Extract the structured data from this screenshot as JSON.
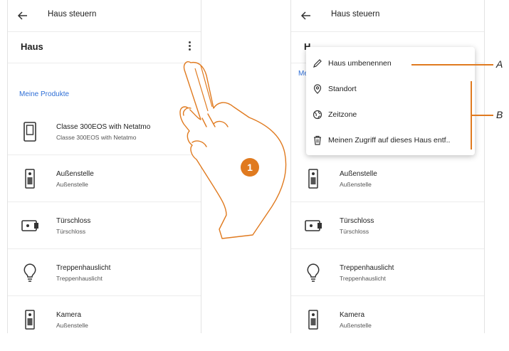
{
  "colors": {
    "accent": "#e07a1f",
    "link": "#2f6fd6"
  },
  "left_screen": {
    "header": {
      "back_icon": "arrow-left-icon",
      "title": "Haus steuern"
    },
    "house": {
      "name": "Haus",
      "menu_icon": "more-vertical-icon"
    },
    "section_label": "Meine Produkte",
    "products": [
      {
        "icon": "video-intercom-icon",
        "name": "Classe 300EOS with Netatmo",
        "sub": "Classe 300EOS with Netatmo"
      },
      {
        "icon": "door-station-icon",
        "name": "Außenstelle",
        "sub": "Außenstelle"
      },
      {
        "icon": "door-lock-icon",
        "name": "Türschloss",
        "sub": "Türschloss"
      },
      {
        "icon": "light-bulb-icon",
        "name": "Treppenhauslicht",
        "sub": "Treppenhauslicht"
      },
      {
        "icon": "door-station-icon",
        "name": "Kamera",
        "sub": "Außenstelle"
      }
    ]
  },
  "right_screen": {
    "header": {
      "back_icon": "arrow-left-icon",
      "title": "Haus steuern"
    },
    "house": {
      "name": "H"
    },
    "section_label": "Me",
    "menu": [
      {
        "icon": "pencil-icon",
        "label": "Haus umbenennen"
      },
      {
        "icon": "location-pin-icon",
        "label": "Standort"
      },
      {
        "icon": "globe-icon",
        "label": "Zeitzone"
      },
      {
        "icon": "trash-icon",
        "label": "Meinen Zugriff auf dieses Haus entf.."
      }
    ],
    "products": [
      {
        "icon": "door-station-icon",
        "name": "Außenstelle",
        "sub": "Außenstelle"
      },
      {
        "icon": "door-lock-icon",
        "name": "Türschloss",
        "sub": "Türschloss"
      },
      {
        "icon": "light-bulb-icon",
        "name": "Treppenhauslicht",
        "sub": "Treppenhauslicht"
      },
      {
        "icon": "door-station-icon",
        "name": "Kamera",
        "sub": "Außenstelle"
      }
    ]
  },
  "annotations": {
    "step": "1",
    "callout_a": "A",
    "callout_b": "B"
  }
}
